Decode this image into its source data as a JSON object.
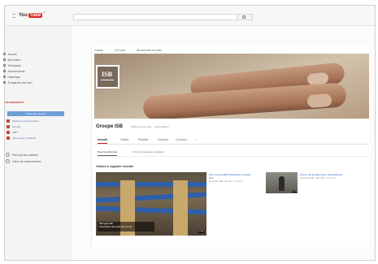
{
  "topbar": {
    "logo_you": "You",
    "logo_tube": "Tube",
    "logo_sup": "FR"
  },
  "sidebar": {
    "nav": [
      {
        "label": "Accueil",
        "icon": "home-icon"
      },
      {
        "label": "Ma chaîne",
        "icon": "user-icon"
      },
      {
        "label": "Tendances",
        "icon": "flame-icon"
      },
      {
        "label": "Abonnements",
        "icon": "subscriptions-icon"
      },
      {
        "label": "Historique",
        "icon": "history-icon"
      },
      {
        "label": "À regarder plus tard",
        "icon": "clock-icon"
      }
    ],
    "subscriptions_heading": "ABONNEMENTS",
    "guide_button": "Guide des chaînes",
    "subscriptions": [
      {
        "label": "Parents pour l'humanité"
      },
      {
        "label": "Groupe"
      },
      {
        "label": "ISBT"
      },
      {
        "label": "Jean-Louis et Juliette"
      }
    ],
    "bottom": [
      {
        "label": "Parcourir les chaînes",
        "icon": "browse-icon"
      },
      {
        "label": "Gérer les abonnements",
        "icon": "settings-icon"
      }
    ]
  },
  "channel": {
    "links": [
      "Cadeau",
      "200 vues",
      "Abonnement de vidéo"
    ],
    "avatar_text": "ISB",
    "title": "Groupe ISB",
    "meta": [
      "Afficher de vos vues",
      "Vous voulez ▾"
    ],
    "tabs": [
      "Accueil",
      "Vidéos",
      "Playlists",
      "Chaînes",
      "À propos"
    ],
    "subtabs": [
      "Pour les abonnés",
      "Pour les nouveaux visiteurs"
    ],
    "section_title": "Vidéos à regarder ensuite",
    "main_video": {
      "caption_line1": "ISB Agglo ABC",
      "caption_line2": "Présentation des outils pour le bois",
      "duration": "1:54"
    },
    "videos": [
      {
        "title": "Film Groupe ISB Présentation l'activité bois",
        "meta": "de Groupe ISB · 1k vues · il y a 1 an"
      },
      {
        "title": "Pinces de Serrage hydro Débordement",
        "meta": "de Groupe ISB · 182 vues · il y a 1 an",
        "duration": "2:04"
      }
    ]
  },
  "colors": {
    "accent": "#cc181e",
    "link": "#1c62b9",
    "guide": "#6f9ed8"
  }
}
